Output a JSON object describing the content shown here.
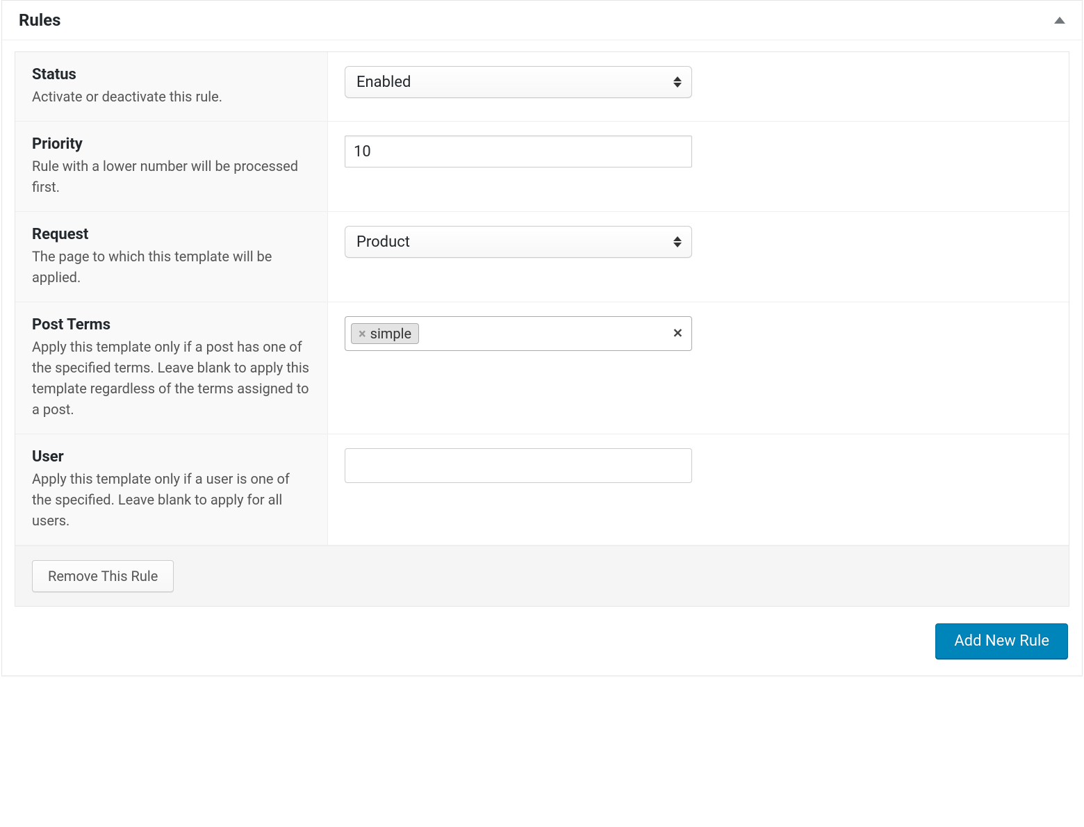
{
  "panel": {
    "title": "Rules"
  },
  "rows": {
    "status": {
      "label": "Status",
      "desc": "Activate or deactivate this rule.",
      "value": "Enabled"
    },
    "priority": {
      "label": "Priority",
      "desc": "Rule with a lower number will be processed first.",
      "value": "10"
    },
    "request": {
      "label": "Request",
      "desc": "The page to which this template will be applied.",
      "value": "Product"
    },
    "post_terms": {
      "label": "Post Terms",
      "desc": "Apply this template only if a post has one of the specified terms. Leave blank to apply this template regardless of the terms assigned to a post.",
      "tags": [
        {
          "text": "simple"
        }
      ]
    },
    "user": {
      "label": "User",
      "desc": "Apply this template only if a user is one of the specified. Leave blank to apply for all users.",
      "value": ""
    }
  },
  "buttons": {
    "remove": "Remove This Rule",
    "add": "Add New Rule"
  },
  "glyphs": {
    "tag_x": "×",
    "clear_x": "✕"
  }
}
